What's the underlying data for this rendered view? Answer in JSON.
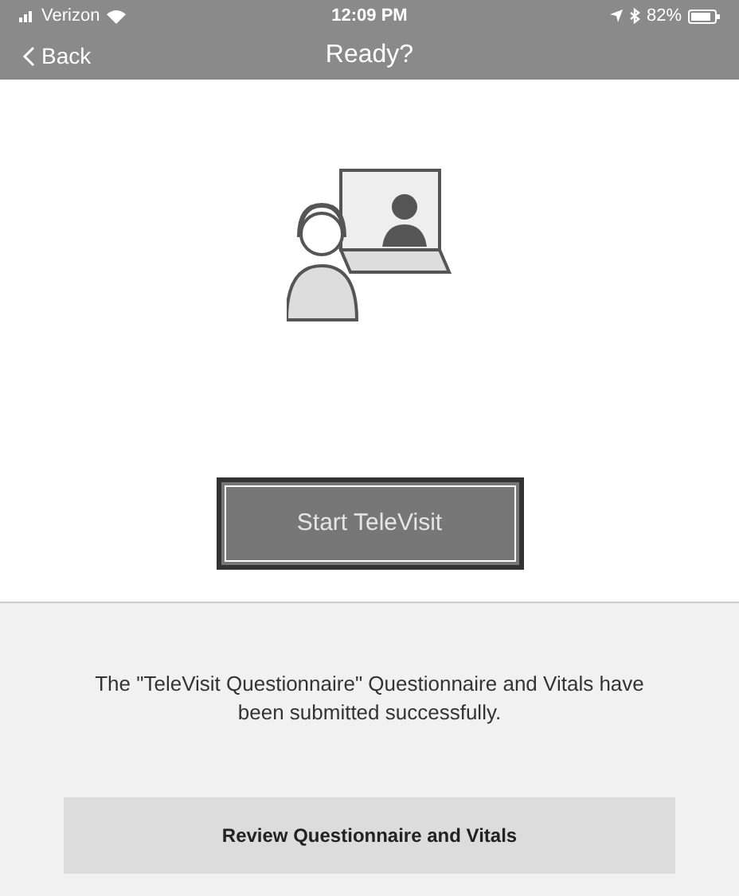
{
  "status_bar": {
    "carrier": "Verizon",
    "time": "12:09 PM",
    "battery": "82%"
  },
  "nav": {
    "back": "Back",
    "title": "Ready?"
  },
  "start_button": "Start TeleVisit",
  "message": "The \"TeleVisit Questionnaire\" Questionnaire and Vitals have been submitted successfully.",
  "review_button": "Review Questionnaire and Vitals"
}
